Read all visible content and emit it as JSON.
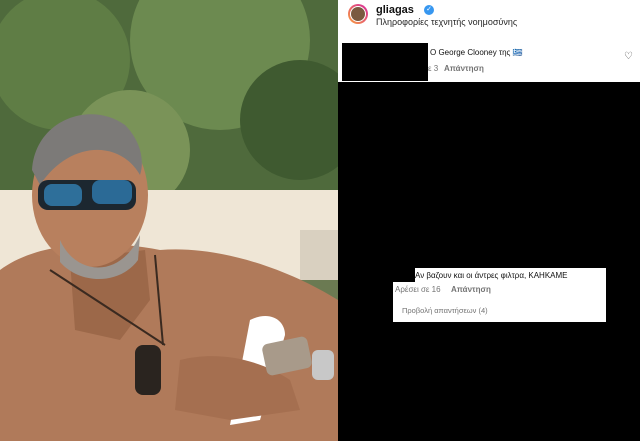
{
  "post": {
    "username": "gliagas",
    "subtitle": "Πληροφορίες τεχνητής νοημοσύνης"
  },
  "comments": [
    {
      "text": "O George Clooney της 🇬🇷",
      "meta_visible": "ε 3",
      "reply_label": "Απάντηση"
    },
    {
      "text": "Αν βαζουν και οι άντρες φιλτρα, ΚΑΗΚΑΜΕ",
      "likes_label": "Αρέσει σε 16",
      "reply_label": "Απάντηση",
      "view_replies_label": "Προβολή απαντήσεων (4)"
    }
  ],
  "icons": {
    "verified": "verified-badge-icon",
    "heart": "heart-icon"
  },
  "colors": {
    "verified": "#3797f0",
    "redaction": "#000000"
  }
}
